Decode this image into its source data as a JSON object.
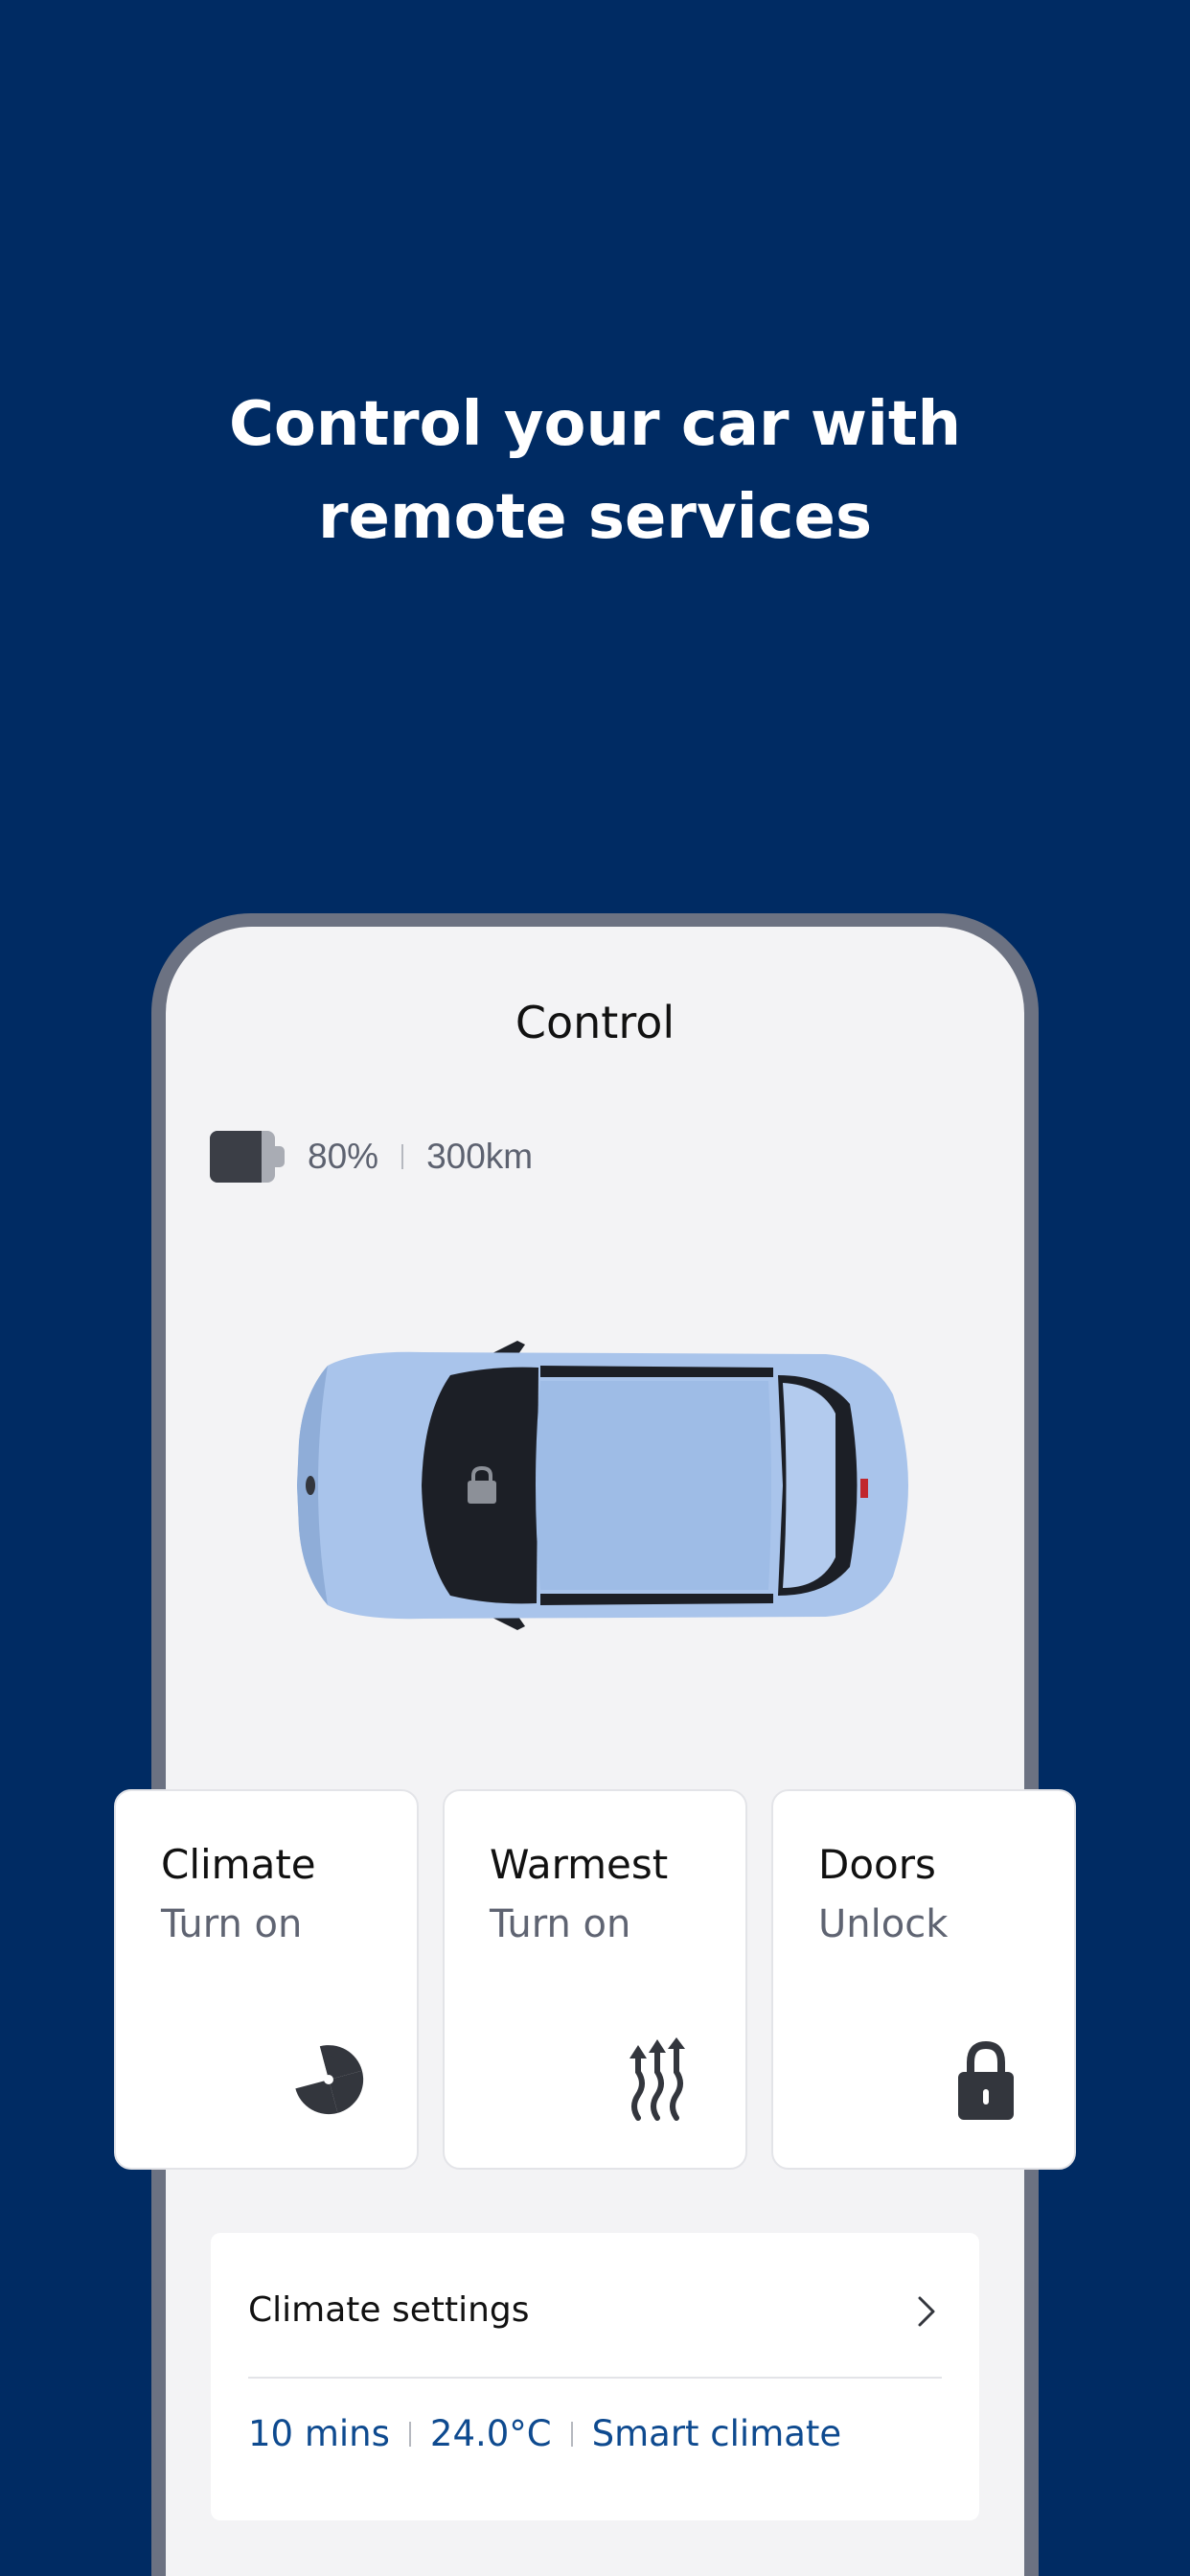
{
  "headline": {
    "line1": "Control your car with",
    "line2": "remote services"
  },
  "screen": {
    "title": "Control",
    "battery": {
      "level_fraction": 0.8,
      "percent_label": "80%",
      "range_label": "300km",
      "icon": "battery-icon"
    },
    "car": {
      "color": "#a9c4eb",
      "lock_icon": "lock-icon"
    },
    "cards": [
      {
        "title": "Climate",
        "action": "Turn on",
        "icon": "fan-icon"
      },
      {
        "title": "Warmest",
        "action": "Turn on",
        "icon": "heat-waves-icon"
      },
      {
        "title": "Doors",
        "action": "Unlock",
        "icon": "padlock-icon"
      }
    ],
    "climate_settings": {
      "title": "Climate settings",
      "chevron_icon": "chevron-right-icon",
      "duration": "10 mins",
      "temperature": "24.0°C",
      "mode": "Smart climate"
    }
  },
  "colors": {
    "background": "#002b63",
    "accent_text": "#0e4a8f",
    "screen_bg": "#f3f3f5"
  }
}
